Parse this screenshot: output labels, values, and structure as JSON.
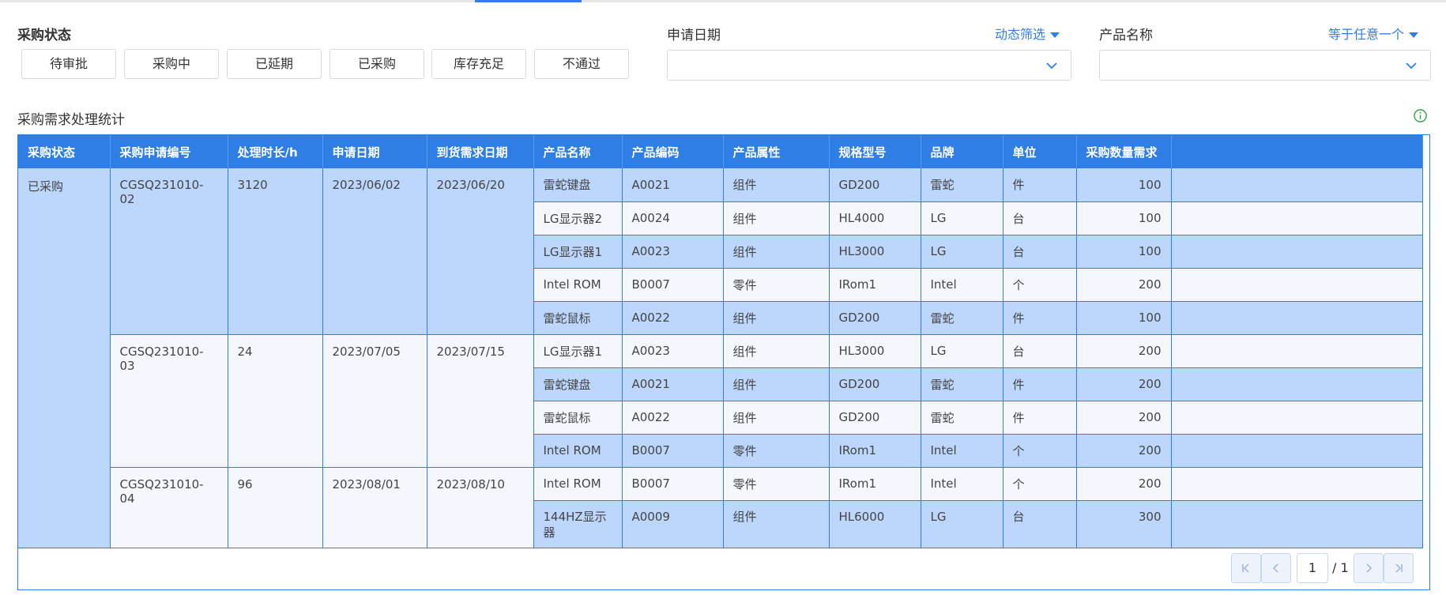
{
  "filters": {
    "status": {
      "title": "采购状态",
      "buttons": [
        "待审批",
        "采购中",
        "已延期",
        "已采购",
        "库存充足",
        "不通过"
      ]
    },
    "apply_date": {
      "title": "申请日期",
      "mode_label": "动态筛选",
      "value": ""
    },
    "product_name": {
      "title": "产品名称",
      "mode_label": "等于任意一个",
      "value": ""
    }
  },
  "section": {
    "title": "采购需求处理统计",
    "info_icon": "info-circle-icon"
  },
  "table": {
    "headers": [
      "采购状态",
      "采购申请编号",
      "处理时长/h",
      "申请日期",
      "到货需求日期",
      "产品名称",
      "产品编码",
      "产品属性",
      "规格型号",
      "品牌",
      "单位",
      "采购数量需求"
    ],
    "status_group": "已采购",
    "groups": [
      {
        "request_no": "CGSQ231010-02",
        "duration": "3120",
        "apply_date": "2023/06/02",
        "due_date": "2023/06/20",
        "rows": [
          {
            "product": "雷蛇键盘",
            "code": "A0021",
            "attr": "组件",
            "spec": "GD200",
            "brand": "雷蛇",
            "unit": "件",
            "qty": "100"
          },
          {
            "product": "LG显示器2",
            "code": "A0024",
            "attr": "组件",
            "spec": "HL4000",
            "brand": "LG",
            "unit": "台",
            "qty": "100"
          },
          {
            "product": "LG显示器1",
            "code": "A0023",
            "attr": "组件",
            "spec": "HL3000",
            "brand": "LG",
            "unit": "台",
            "qty": "100"
          },
          {
            "product": "Intel ROM",
            "code": "B0007",
            "attr": "零件",
            "spec": "IRom1",
            "brand": "Intel",
            "unit": "个",
            "qty": "200"
          },
          {
            "product": "雷蛇鼠标",
            "code": "A0022",
            "attr": "组件",
            "spec": "GD200",
            "brand": "雷蛇",
            "unit": "件",
            "qty": "100"
          }
        ]
      },
      {
        "request_no": "CGSQ231010-03",
        "duration": "24",
        "apply_date": "2023/07/05",
        "due_date": "2023/07/15",
        "rows": [
          {
            "product": "LG显示器1",
            "code": "A0023",
            "attr": "组件",
            "spec": "HL3000",
            "brand": "LG",
            "unit": "台",
            "qty": "200"
          },
          {
            "product": "雷蛇键盘",
            "code": "A0021",
            "attr": "组件",
            "spec": "GD200",
            "brand": "雷蛇",
            "unit": "件",
            "qty": "200"
          },
          {
            "product": "雷蛇鼠标",
            "code": "A0022",
            "attr": "组件",
            "spec": "GD200",
            "brand": "雷蛇",
            "unit": "件",
            "qty": "200"
          },
          {
            "product": "Intel ROM",
            "code": "B0007",
            "attr": "零件",
            "spec": "IRom1",
            "brand": "Intel",
            "unit": "个",
            "qty": "200"
          }
        ]
      },
      {
        "request_no": "CGSQ231010-04",
        "duration": "96",
        "apply_date": "2023/08/01",
        "due_date": "2023/08/10",
        "rows": [
          {
            "product": "Intel ROM",
            "code": "B0007",
            "attr": "零件",
            "spec": "IRom1",
            "brand": "Intel",
            "unit": "个",
            "qty": "200"
          },
          {
            "product": "144HZ显示器",
            "code": "A0009",
            "attr": "组件",
            "spec": "HL6000",
            "brand": "LG",
            "unit": "台",
            "qty": "300"
          }
        ]
      }
    ]
  },
  "pagination": {
    "current_page": "1",
    "total_label": "/ 1"
  },
  "colors": {
    "accent": "#2f7ee6",
    "row_highlight": "#bdd6fb",
    "row_plain": "#f4f8fe"
  }
}
